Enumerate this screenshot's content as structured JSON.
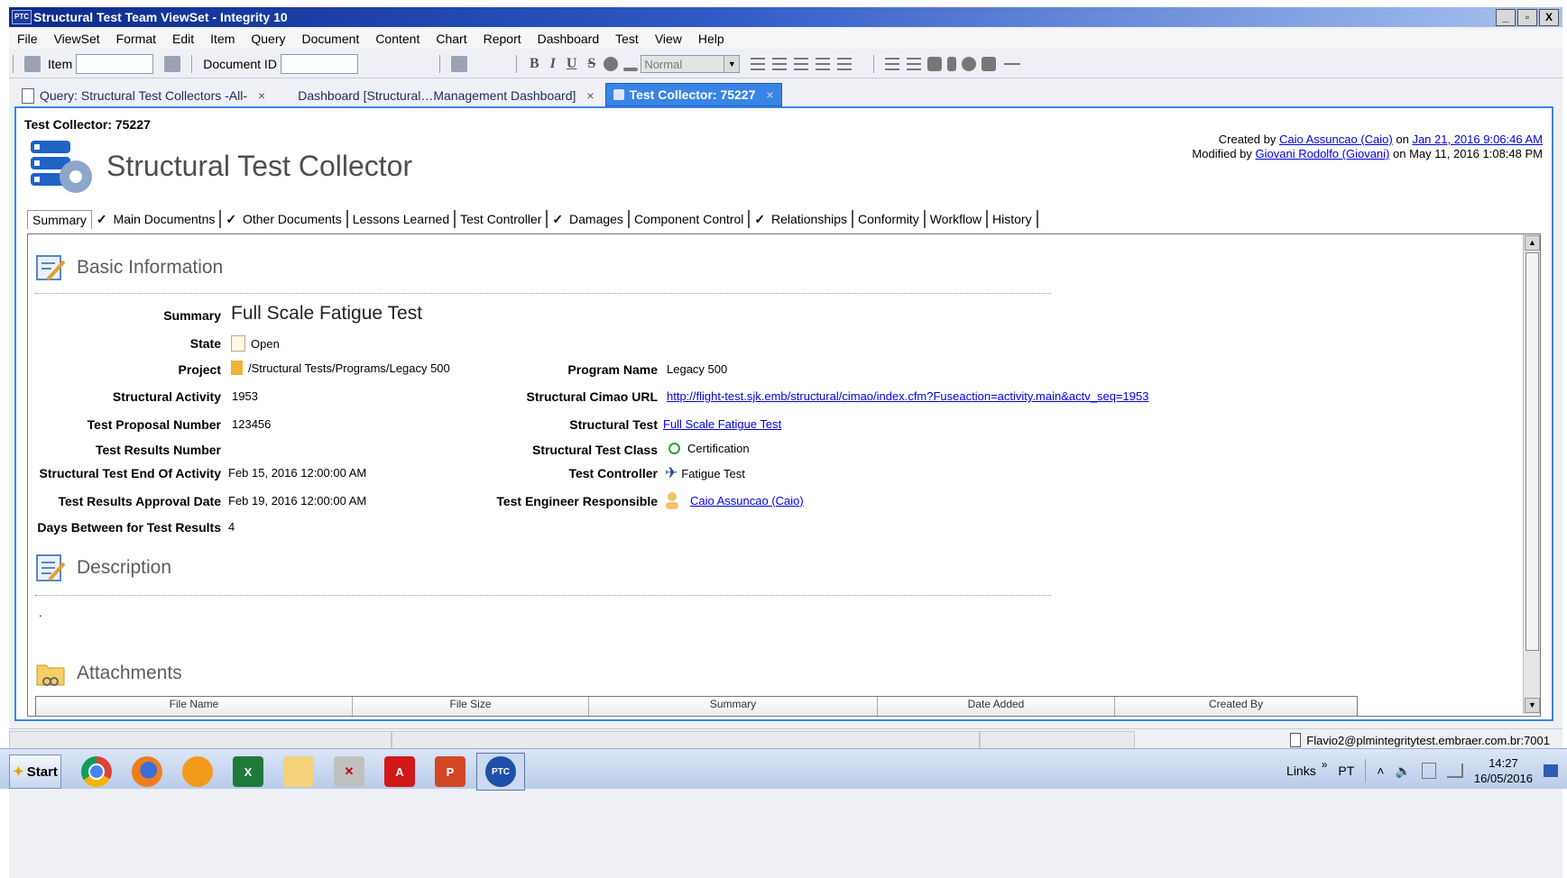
{
  "window": {
    "title": "Structural Test Team ViewSet - Integrity 10",
    "app_badge": "PTC",
    "btn_min": "_",
    "btn_restore": "▫",
    "btn_close": "X"
  },
  "menu": [
    "File",
    "ViewSet",
    "Format",
    "Edit",
    "Item",
    "Query",
    "Document",
    "Content",
    "Chart",
    "Report",
    "Dashboard",
    "Test",
    "View",
    "Help"
  ],
  "toolbar": {
    "item_label": "Item",
    "document_id_label": "Document ID",
    "style_value": "Normal",
    "bold": "B",
    "italic": "I",
    "underline": "U",
    "strike": "S"
  },
  "doc_tabs": [
    {
      "label": "Query: Structural Test Collectors -All-",
      "close": "×"
    },
    {
      "label": "Dashboard [Structural…Management Dashboard]",
      "close": "×"
    },
    {
      "label": "Test Collector: 75227",
      "close": "×"
    }
  ],
  "header": {
    "title": "Test Collector: 75227",
    "type_name": "Structural Test Collector",
    "created_prefix": "Created by",
    "created_by": "Caio Assuncao (Caio)",
    "created_on_word": "on",
    "created_on": "Jan 21, 2016 9:06:46 AM",
    "modified_prefix": "Modified by",
    "modified_by": "Giovani Rodolfo (Giovani)",
    "modified_on": "on May 11, 2016 1:08:48 PM"
  },
  "subtabs": [
    {
      "label": "Summary",
      "checked": false
    },
    {
      "label": "Main Documentns",
      "checked": true
    },
    {
      "label": "Other Documents",
      "checked": true
    },
    {
      "label": "Lessons Learned",
      "checked": false
    },
    {
      "label": "Test Controller",
      "checked": false
    },
    {
      "label": "Damages",
      "checked": true
    },
    {
      "label": "Component Control",
      "checked": false
    },
    {
      "label": "Relationships",
      "checked": true
    },
    {
      "label": "Conformity",
      "checked": false
    },
    {
      "label": "Workflow",
      "checked": false
    },
    {
      "label": "History",
      "checked": false
    }
  ],
  "check_mark": "✓",
  "sections": {
    "basic": "Basic Information",
    "description": "Description",
    "attachments": "Attachments"
  },
  "fields": {
    "summary": {
      "label": "Summary",
      "value": "Full Scale Fatigue Test"
    },
    "state": {
      "label": "State",
      "value": "Open"
    },
    "project": {
      "label": "Project",
      "value": "/Structural Tests/Programs/Legacy 500"
    },
    "program_name": {
      "label": "Program Name",
      "value": "Legacy 500"
    },
    "structural_activity": {
      "label": "Structural Activity",
      "value": "1953"
    },
    "cimao_url": {
      "label": "Structural Cimao URL",
      "value": "http://flight-test.sjk.emb/structural/cimao/index.cfm?Fuseaction=activity.main&actv_seq=1953"
    },
    "test_proposal": {
      "label": "Test Proposal Number",
      "value": "123456"
    },
    "structural_test": {
      "label": "Structural Test",
      "value": "Full Scale Fatigue Test"
    },
    "test_results_number": {
      "label": "Test Results Number",
      "value": ""
    },
    "structural_test_class": {
      "label": "Structural Test Class",
      "value": "Certification"
    },
    "end_of_activity": {
      "label": "Structural Test End Of Activity",
      "value": "Feb 15, 2016 12:00:00 AM"
    },
    "test_controller": {
      "label": "Test Controller",
      "value": "Fatigue Test"
    },
    "approval_date": {
      "label": "Test Results Approval Date",
      "value": "Feb 19, 2016 12:00:00 AM"
    },
    "engineer": {
      "label": "Test Engineer Responsible",
      "value": "Caio Assuncao (Caio)"
    },
    "days_between": {
      "label": "Days Between for Test Results",
      "value": "4"
    }
  },
  "description_text": ".",
  "attachments_columns": [
    "File Name",
    "File Size",
    "Summary",
    "Date Added",
    "Created By"
  ],
  "status": {
    "server": "Flavio2@plmintegritytest.embraer.com.br:7001"
  },
  "taskbar": {
    "start": "Start",
    "links": "Links",
    "lang": "PT",
    "time": "14:27",
    "date": "16/05/2016",
    "chevrons": "»",
    "tray_up": "˄",
    "ptc": "PTC"
  },
  "colors": {
    "accent": "#3a84e5",
    "link": "#0000ee",
    "title_gradient_start": "#0b2a8a"
  }
}
